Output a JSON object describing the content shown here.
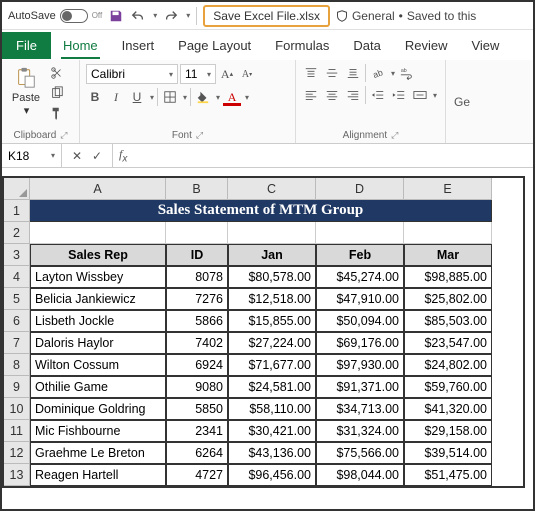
{
  "titleBar": {
    "autosave_label": "AutoSave",
    "autosave_state": "Off",
    "filename": "Save Excel File.xlsx",
    "sensitivity": "General",
    "save_status": "Saved to this"
  },
  "tabs": {
    "file": "File",
    "items": [
      "Home",
      "Insert",
      "Page Layout",
      "Formulas",
      "Data",
      "Review",
      "View"
    ],
    "active": "Home"
  },
  "ribbon": {
    "clipboard": {
      "label": "Clipboard",
      "paste": "Paste"
    },
    "font": {
      "label": "Font",
      "name": "Calibri",
      "size": "11",
      "buttons": {
        "b": "B",
        "i": "I",
        "u": "U"
      }
    },
    "alignment": {
      "label": "Alignment"
    },
    "extra_hint": "Ge"
  },
  "nameBox": {
    "ref": "K18"
  },
  "sheet": {
    "cols": [
      "A",
      "B",
      "C",
      "D",
      "E"
    ],
    "title": "Sales Statement of MTM Group",
    "headers": [
      "Sales Rep",
      "ID",
      "Jan",
      "Feb",
      "Mar"
    ],
    "rows": [
      {
        "n": 4,
        "rep": "Layton Wissbey",
        "id": "8078",
        "jan": "$80,578.00",
        "feb": "$45,274.00",
        "mar": "$98,885.00"
      },
      {
        "n": 5,
        "rep": "Belicia Jankiewicz",
        "id": "7276",
        "jan": "$12,518.00",
        "feb": "$47,910.00",
        "mar": "$25,802.00"
      },
      {
        "n": 6,
        "rep": "Lisbeth Jockle",
        "id": "5866",
        "jan": "$15,855.00",
        "feb": "$50,094.00",
        "mar": "$85,503.00"
      },
      {
        "n": 7,
        "rep": "Daloris Haylor",
        "id": "7402",
        "jan": "$27,224.00",
        "feb": "$69,176.00",
        "mar": "$23,547.00"
      },
      {
        "n": 8,
        "rep": "Wilton Cossum",
        "id": "6924",
        "jan": "$71,677.00",
        "feb": "$97,930.00",
        "mar": "$24,802.00"
      },
      {
        "n": 9,
        "rep": "Othilie Game",
        "id": "9080",
        "jan": "$24,581.00",
        "feb": "$91,371.00",
        "mar": "$59,760.00"
      },
      {
        "n": 10,
        "rep": "Dominique Goldring",
        "id": "5850",
        "jan": "$58,110.00",
        "feb": "$34,713.00",
        "mar": "$41,320.00"
      },
      {
        "n": 11,
        "rep": "Mic Fishbourne",
        "id": "2341",
        "jan": "$30,421.00",
        "feb": "$31,324.00",
        "mar": "$29,158.00"
      },
      {
        "n": 12,
        "rep": "Graehme Le Breton",
        "id": "6264",
        "jan": "$43,136.00",
        "feb": "$75,566.00",
        "mar": "$39,514.00"
      },
      {
        "n": 13,
        "rep": "Reagen Hartell",
        "id": "4727",
        "jan": "$96,456.00",
        "feb": "$98,044.00",
        "mar": "$51,475.00"
      }
    ]
  }
}
